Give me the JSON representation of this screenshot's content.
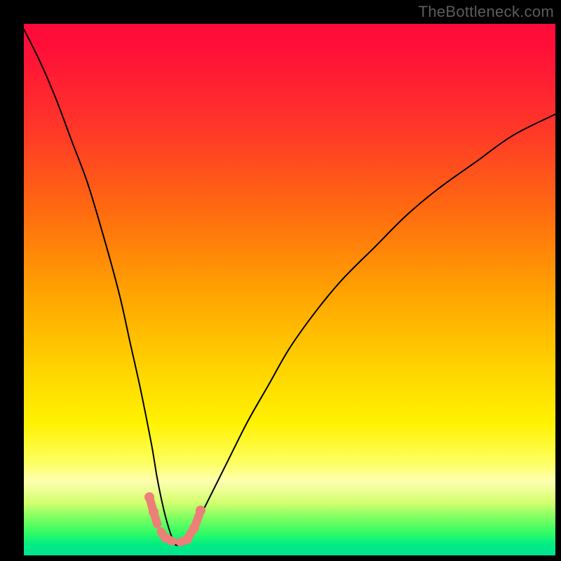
{
  "watermark": "TheBottleneck.com",
  "chart_data": {
    "type": "line",
    "title": "",
    "xlabel": "",
    "ylabel": "",
    "xlim": [
      0,
      100
    ],
    "ylim": [
      0,
      100
    ],
    "legend": false,
    "grid": false,
    "background": "rainbow-vertical-gradient",
    "series": [
      {
        "name": "bottleneck-curve",
        "x": [
          0,
          3,
          6,
          9,
          12,
          15,
          18,
          20,
          22,
          24,
          25,
          26,
          27,
          28,
          28.5,
          30,
          31,
          33,
          35,
          38,
          42,
          46,
          50,
          55,
          60,
          66,
          72,
          78,
          85,
          92,
          100
        ],
        "y": [
          99,
          93,
          86,
          78,
          70,
          60,
          49,
          40,
          31,
          21,
          15,
          10,
          6,
          3,
          2,
          2,
          3,
          7,
          11,
          17,
          25,
          32,
          39,
          46,
          52,
          58,
          64,
          69,
          74,
          79,
          83
        ]
      }
    ],
    "highlight": {
      "name": "optimal-range",
      "color": "#ec7f78",
      "points": [
        {
          "x": 23.6,
          "y": 11.0
        },
        {
          "x": 24.4,
          "y": 8.2
        },
        {
          "x": 25.3,
          "y": 5.2
        },
        {
          "x": 26.6,
          "y": 3.3
        },
        {
          "x": 28.6,
          "y": 2.3
        },
        {
          "x": 30.7,
          "y": 3.0
        },
        {
          "x": 32.0,
          "y": 5.2
        },
        {
          "x": 33.2,
          "y": 8.4
        }
      ]
    }
  }
}
